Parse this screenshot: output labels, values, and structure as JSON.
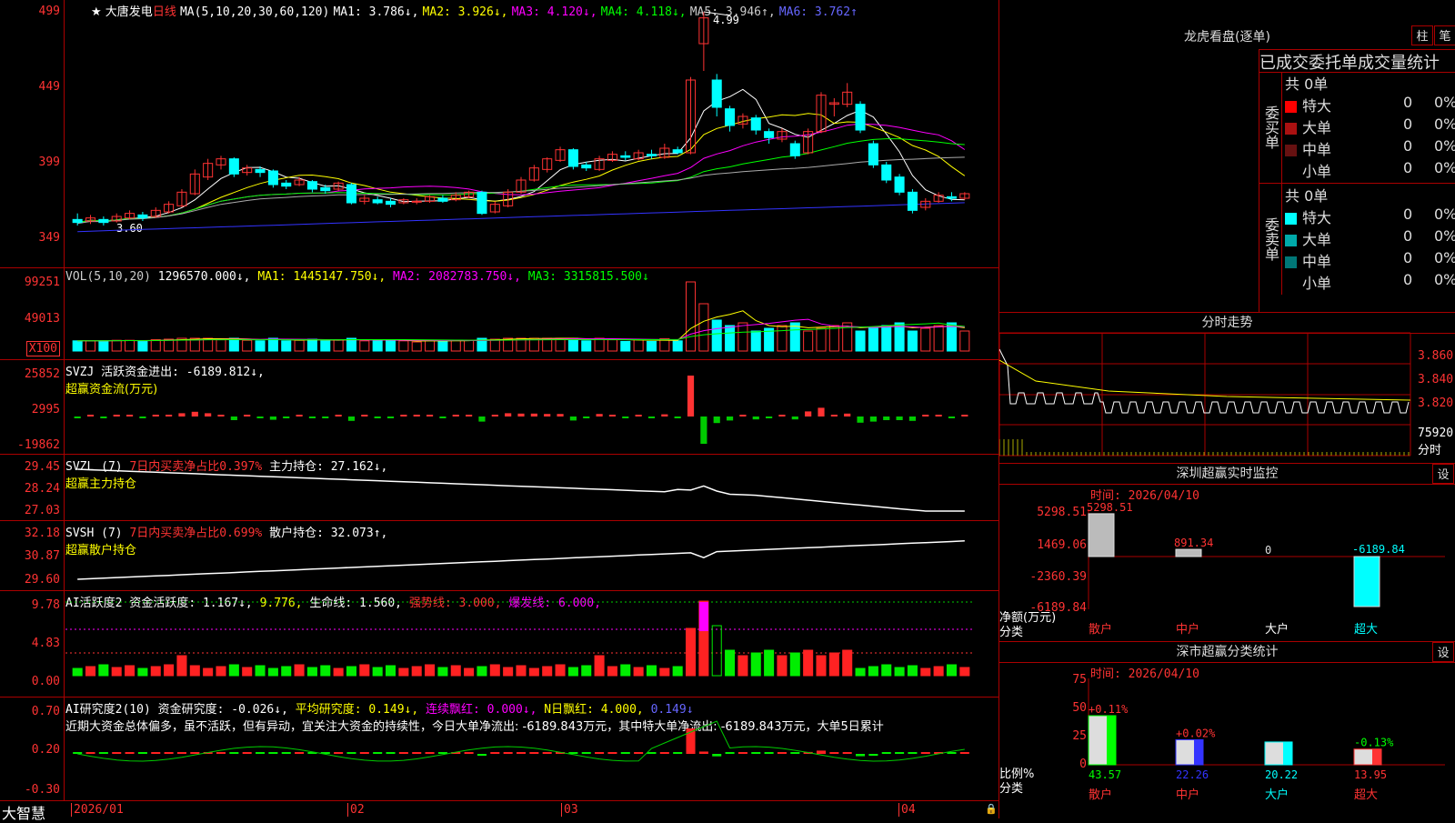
{
  "stock": {
    "title": "大唐发电",
    "period": "日线",
    "star": "★"
  },
  "ma_header": {
    "label": "MA(5,10,20,30,60,120)",
    "ma1": "MA1: 3.786↓,",
    "ma2": "MA2: 3.926↓,",
    "ma3": "MA3: 4.120↓,",
    "ma4": "MA4: 4.118↓,",
    "ma5": "MA5: 3.946↑,",
    "ma6": "MA6: 3.762↑",
    "peak": "4.99",
    "low_mark": "3.60"
  },
  "price_axis": [
    "499",
    "449",
    "399",
    "349"
  ],
  "vol_header": {
    "label": "VOL(5,10,20)",
    "value": "1296570.000↓,",
    "ma1": "MA1: 1445147.750↓,",
    "ma2": "MA2: 2082783.750↓,",
    "ma3": "MA3: 3315815.500↓"
  },
  "vol_axis": [
    "99251",
    "49013",
    "X100"
  ],
  "svzj": {
    "line1": "SVZJ  活跃资金进出: -6189.812↓,",
    "line2": "超赢资金流(万元)",
    "axis": [
      "25852",
      "2995",
      "-19862"
    ]
  },
  "svzl": {
    "name": "SVZL (7)",
    "ratio": "7日内买卖净占比0.397%",
    "hold": "主力持仓: 27.162↓,",
    "line2": "超赢主力持仓",
    "axis": [
      "29.45",
      "28.24",
      "27.03"
    ]
  },
  "svsh": {
    "name": "SVSH (7)",
    "ratio": "7日内买卖净占比0.699%",
    "hold": "散户持仓: 32.073↑,",
    "line2": "超赢散户持仓",
    "axis": [
      "32.18",
      "30.87",
      "29.60"
    ]
  },
  "ai_active": {
    "name": "AI活跃度2",
    "v1": "资金活跃度: 1.167↓,",
    "v2": "9.776,",
    "v3": "生命线: 1.560,",
    "v4": "强势线: 3.000,",
    "v5": "爆发线: 6.000,",
    "axis": [
      "9.78",
      "4.83",
      "0.00"
    ]
  },
  "ai_research": {
    "name": "AI研究度2(10)",
    "v1": "资金研究度: -0.026↓,",
    "v2": "平均研究度: 0.149↓,",
    "v3": "连续飘红: 0.000↓,",
    "v4": "N日飘红: 4.000,",
    "v5": "0.149↓",
    "note": "近期大资金总体偏多，虽不活跃，但有异动，宜关注大资金的持续性，今日大单净流出: -6189.843万元，其中特大单净流出: -6189.843万元，大单5日累计",
    "axis": [
      "0.70",
      "0.20",
      "-0.30"
    ]
  },
  "x_axis": [
    "2026/01",
    "02",
    "03",
    "04"
  ],
  "brand": "大智慧",
  "dragon": {
    "title": "龙虎看盘(逐单)",
    "btn1": "柱",
    "btn2": "笔",
    "tabs": "已成交委托单成交量统计",
    "buy_label": "委买单",
    "sell_label": "委卖单",
    "buy_total": "共 0单",
    "sell_total": "共 0单",
    "buy_rows": [
      {
        "label": "特大",
        "n": "0",
        "p": "0%",
        "color": "#ff0000"
      },
      {
        "label": "大单",
        "n": "0",
        "p": "0%",
        "color": "#aa1111"
      },
      {
        "label": "中单",
        "n": "0",
        "p": "0%",
        "color": "#661111"
      },
      {
        "label": "小单",
        "n": "0",
        "p": "0%",
        "color": "#000000"
      }
    ],
    "sell_rows": [
      {
        "label": "特大",
        "n": "0",
        "p": "0%",
        "color": "#00ffff"
      },
      {
        "label": "大单",
        "n": "0",
        "p": "0%",
        "color": "#00aaaa"
      },
      {
        "label": "中单",
        "n": "0",
        "p": "0%",
        "color": "#007777"
      },
      {
        "label": "小单",
        "n": "0",
        "p": "0%",
        "color": "#000000"
      }
    ]
  },
  "intraday": {
    "title": "分时走势",
    "p1": "3.860",
    "p2": "3.840",
    "p3": "3.820",
    "vol": "75920",
    "vol_label": "分时"
  },
  "sz_monitor": {
    "title": "深圳超赢实时监控",
    "btn": "设",
    "time": "时间: 2026/04/10",
    "axis": [
      "5298.51",
      "1469.06",
      "-2360.39",
      "-6189.84"
    ],
    "ylabel": "净额(万元)",
    "xlabel": "分类",
    "cats": [
      "散户",
      "中户",
      "大户",
      "超大"
    ],
    "values": [
      "5298.51",
      "891.34",
      "0",
      "-6189.84"
    ]
  },
  "sz_class": {
    "title": "深市超赢分类统计",
    "btn": "设",
    "time": "时间: 2026/04/10",
    "axis": [
      "75",
      "50",
      "25",
      "0"
    ],
    "ylabel": "比例%",
    "xlabel": "分类",
    "cats": [
      "散户",
      "中户",
      "大户",
      "超大"
    ],
    "pct": [
      "43.57",
      "22.26",
      "20.22",
      "13.95"
    ],
    "chg": [
      "+0.11%",
      "+0.02%",
      "",
      "-0.13%"
    ]
  },
  "chart_data": [
    {
      "type": "candlestick",
      "title": "大唐发电 日线",
      "ylim": [
        3.4,
        5.1
      ],
      "candles": [
        [
          3.62,
          3.6,
          3.66,
          3.58
        ],
        [
          3.61,
          3.63,
          3.65,
          3.59
        ],
        [
          3.62,
          3.6,
          3.64,
          3.58
        ],
        [
          3.61,
          3.64,
          3.66,
          3.6
        ],
        [
          3.63,
          3.66,
          3.68,
          3.62
        ],
        [
          3.65,
          3.63,
          3.67,
          3.61
        ],
        [
          3.64,
          3.68,
          3.7,
          3.63
        ],
        [
          3.67,
          3.72,
          3.74,
          3.66
        ],
        [
          3.71,
          3.8,
          3.82,
          3.7
        ],
        [
          3.79,
          3.92,
          3.95,
          3.78
        ],
        [
          3.9,
          3.99,
          4.02,
          3.88
        ],
        [
          3.98,
          4.02,
          4.04,
          3.95
        ],
        [
          4.02,
          3.92,
          4.03,
          3.9
        ],
        [
          3.93,
          3.96,
          3.98,
          3.91
        ],
        [
          3.95,
          3.93,
          3.97,
          3.9
        ],
        [
          3.94,
          3.85,
          3.95,
          3.83
        ],
        [
          3.86,
          3.84,
          3.88,
          3.82
        ],
        [
          3.85,
          3.88,
          3.9,
          3.84
        ],
        [
          3.87,
          3.82,
          3.88,
          3.8
        ],
        [
          3.83,
          3.81,
          3.85,
          3.79
        ],
        [
          3.82,
          3.86,
          3.87,
          3.81
        ],
        [
          3.85,
          3.73,
          3.86,
          3.72
        ],
        [
          3.74,
          3.76,
          3.78,
          3.72
        ],
        [
          3.75,
          3.73,
          3.77,
          3.72
        ],
        [
          3.74,
          3.72,
          3.76,
          3.7
        ],
        [
          3.73,
          3.75,
          3.76,
          3.72
        ],
        [
          3.74,
          3.74,
          3.76,
          3.72
        ],
        [
          3.74,
          3.77,
          3.78,
          3.73
        ],
        [
          3.76,
          3.74,
          3.78,
          3.73
        ],
        [
          3.75,
          3.78,
          3.8,
          3.74
        ],
        [
          3.77,
          3.8,
          3.81,
          3.76
        ],
        [
          3.8,
          3.66,
          3.81,
          3.65
        ],
        [
          3.67,
          3.72,
          3.74,
          3.66
        ],
        [
          3.71,
          3.8,
          3.82,
          3.7
        ],
        [
          3.8,
          3.88,
          3.9,
          3.79
        ],
        [
          3.88,
          3.96,
          3.98,
          3.87
        ],
        [
          3.95,
          4.02,
          4.03,
          3.93
        ],
        [
          4.01,
          4.08,
          4.1,
          4.0
        ],
        [
          4.08,
          3.97,
          4.09,
          3.95
        ],
        [
          3.98,
          3.96,
          4.0,
          3.94
        ],
        [
          3.95,
          4.02,
          4.04,
          3.94
        ],
        [
          4.01,
          4.05,
          4.07,
          4.0
        ],
        [
          4.04,
          4.03,
          4.07,
          4.01
        ],
        [
          4.02,
          4.06,
          4.08,
          4.01
        ],
        [
          4.05,
          4.04,
          4.08,
          4.02
        ],
        [
          4.03,
          4.09,
          4.12,
          4.02
        ],
        [
          4.08,
          4.06,
          4.1,
          4.05
        ],
        [
          4.06,
          4.54,
          4.56,
          4.05
        ],
        [
          4.78,
          4.95,
          4.99,
          4.6
        ],
        [
          4.54,
          4.36,
          4.58,
          4.3
        ],
        [
          4.35,
          4.24,
          4.37,
          4.2
        ],
        [
          4.25,
          4.3,
          4.32,
          4.22
        ],
        [
          4.29,
          4.21,
          4.31,
          4.18
        ],
        [
          4.2,
          4.16,
          4.22,
          4.12
        ],
        [
          4.15,
          4.2,
          4.22,
          4.13
        ],
        [
          4.12,
          4.04,
          4.14,
          4.02
        ],
        [
          4.06,
          4.2,
          4.22,
          4.05
        ],
        [
          4.2,
          4.44,
          4.46,
          4.19
        ],
        [
          4.38,
          4.39,
          4.42,
          4.3
        ],
        [
          4.38,
          4.46,
          4.52,
          4.36
        ],
        [
          4.38,
          4.21,
          4.4,
          4.19
        ],
        [
          4.12,
          3.98,
          4.14,
          3.96
        ],
        [
          3.98,
          3.88,
          4.0,
          3.86
        ],
        [
          3.9,
          3.8,
          3.92,
          3.78
        ],
        [
          3.8,
          3.68,
          3.82,
          3.66
        ],
        [
          3.7,
          3.74,
          3.76,
          3.68
        ],
        [
          3.74,
          3.78,
          3.8,
          3.73
        ],
        [
          3.77,
          3.76,
          3.8,
          3.74
        ],
        [
          3.76,
          3.79,
          3.8,
          3.75
        ]
      ]
    }
  ]
}
